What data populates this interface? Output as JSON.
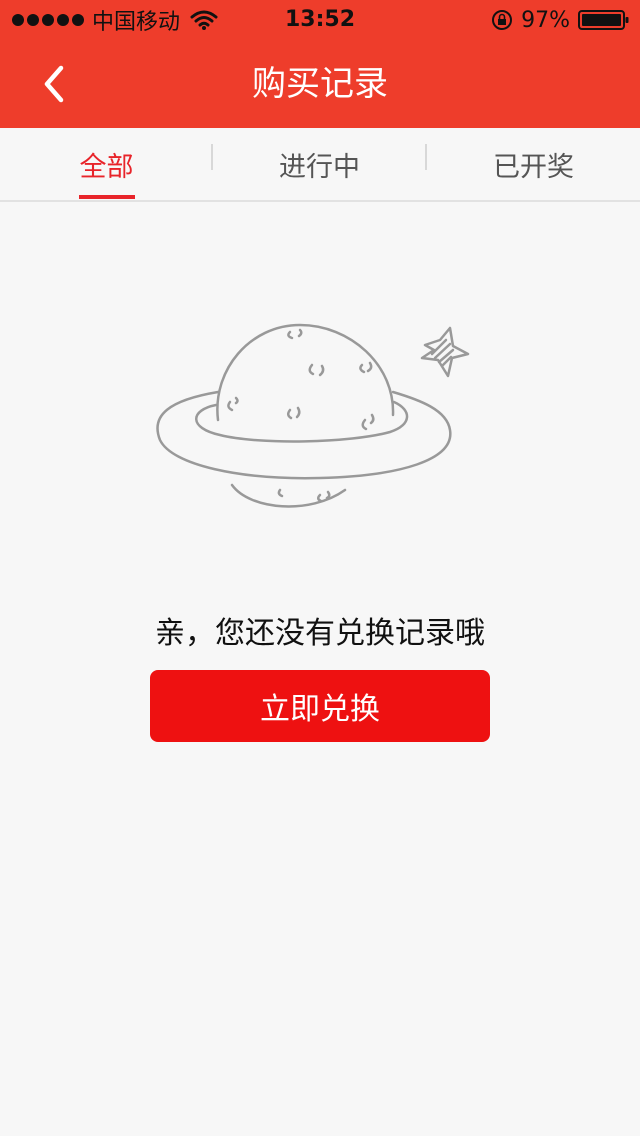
{
  "status_bar": {
    "carrier": "中国移动",
    "time": "13:52",
    "battery_percent": "97%",
    "icons": [
      "signal-dots-icon",
      "wifi-icon",
      "rotation-lock-icon",
      "battery-icon"
    ]
  },
  "nav": {
    "title": "购买记录",
    "back_icon": "chevron-left-icon"
  },
  "tabs": [
    {
      "label": "全部",
      "active": true
    },
    {
      "label": "进行中",
      "active": false
    },
    {
      "label": "已开奖",
      "active": false
    }
  ],
  "empty_state": {
    "illustration_icon": "planet-icon",
    "message": "亲，您还没有兑换记录哦",
    "button_label": "立即兑换"
  },
  "colors": {
    "header": "#ee3d2b",
    "accent": "#e8242a",
    "button": "#ee1111",
    "background": "#f7f7f7"
  }
}
